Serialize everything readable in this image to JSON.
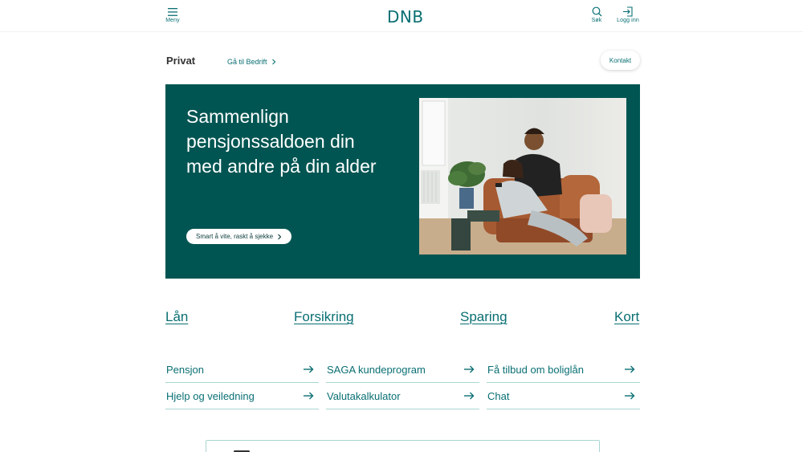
{
  "header": {
    "menu_label": "Meny",
    "logo_text": "DNB",
    "search_label": "Søk",
    "login_label": "Logg inn"
  },
  "subnav": {
    "title": "Privat",
    "business_link": "Gå til Bedrift",
    "contact_label": "Kontakt"
  },
  "hero": {
    "title": "Sammenlign pensjonssaldoen din med andre på din alder",
    "cta": "Smart å vite, raskt å sjekke"
  },
  "categories": [
    "Lån",
    "Forsikring",
    "Sparing",
    "Kort"
  ],
  "quick_links": [
    "Pensjon",
    "SAGA kundeprogram",
    "Få tilbud om boliglån",
    "Hjelp og veiledning",
    "Valutakalkulator",
    "Chat"
  ],
  "colors": {
    "brand": "#0a6f73",
    "hero_bg": "#005552",
    "divider": "#a9d6d2"
  }
}
